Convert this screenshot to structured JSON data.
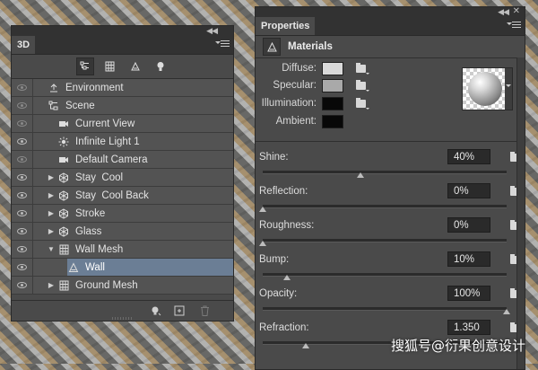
{
  "panel3d": {
    "tab_label": "3D",
    "toolbar_icons": [
      "scene-filter-icon",
      "mesh-filter-icon",
      "material-filter-icon",
      "light-filter-icon"
    ],
    "layers": [
      {
        "label": "Environment",
        "icon": "environment-icon",
        "level": 0,
        "expand": "",
        "eye": "dim"
      },
      {
        "label": "Scene",
        "icon": "scene-icon",
        "level": 0,
        "expand": "",
        "eye": "dim"
      },
      {
        "label": "Current View",
        "icon": "camera-icon",
        "level": 1,
        "expand": "",
        "eye": "dim"
      },
      {
        "label": "Infinite Light 1",
        "icon": "light-icon",
        "level": 1,
        "expand": "",
        "eye": "on"
      },
      {
        "label": "Default Camera",
        "icon": "camera-icon",
        "level": 1,
        "expand": "",
        "eye": "dim"
      },
      {
        "label": "Stay  Cool",
        "icon": "mesh-icon",
        "level": 1,
        "expand": "▶",
        "eye": "on"
      },
      {
        "label": "Stay  Cool Back",
        "icon": "mesh-icon",
        "level": 1,
        "expand": "▶",
        "eye": "on"
      },
      {
        "label": "Stroke",
        "icon": "mesh-icon",
        "level": 1,
        "expand": "▶",
        "eye": "on"
      },
      {
        "label": "Glass",
        "icon": "mesh-icon",
        "level": 1,
        "expand": "▶",
        "eye": "on"
      },
      {
        "label": "Wall Mesh",
        "icon": "grid-mesh-icon",
        "level": 1,
        "expand": "▼",
        "eye": "on"
      },
      {
        "label": "Wall",
        "icon": "material-icon",
        "level": 2,
        "expand": "",
        "eye": "on",
        "selected": true
      },
      {
        "label": "Ground Mesh",
        "icon": "grid-mesh-icon",
        "level": 1,
        "expand": "▶",
        "eye": "on"
      }
    ],
    "bottom_icons": [
      "add-light-icon",
      "new-layer-icon",
      "trash-icon"
    ]
  },
  "properties": {
    "tab_label": "Properties",
    "header_title": "Materials",
    "colors": [
      {
        "label": "Diffuse:",
        "color": "#d9d9d9"
      },
      {
        "label": "Specular:",
        "color": "#a9a9a9"
      },
      {
        "label": "Illumination:",
        "color": "#080808"
      },
      {
        "label": "Ambient:",
        "color": "#080808"
      }
    ],
    "sliders": [
      {
        "label": "Shine:",
        "value": "40%",
        "level": 0.4
      },
      {
        "label": "Reflection:",
        "value": "0%",
        "level": 0.0
      },
      {
        "label": "Roughness:",
        "value": "0%",
        "level": 0.0
      },
      {
        "label": "Bump:",
        "value": "10%",
        "level": 0.1
      },
      {
        "label": "Opacity:",
        "value": "100%",
        "level": 1.0
      },
      {
        "label": "Refraction:",
        "value": "1.350",
        "level": 0.175
      }
    ]
  },
  "watermark": "搜狐号@衍果创意设计"
}
